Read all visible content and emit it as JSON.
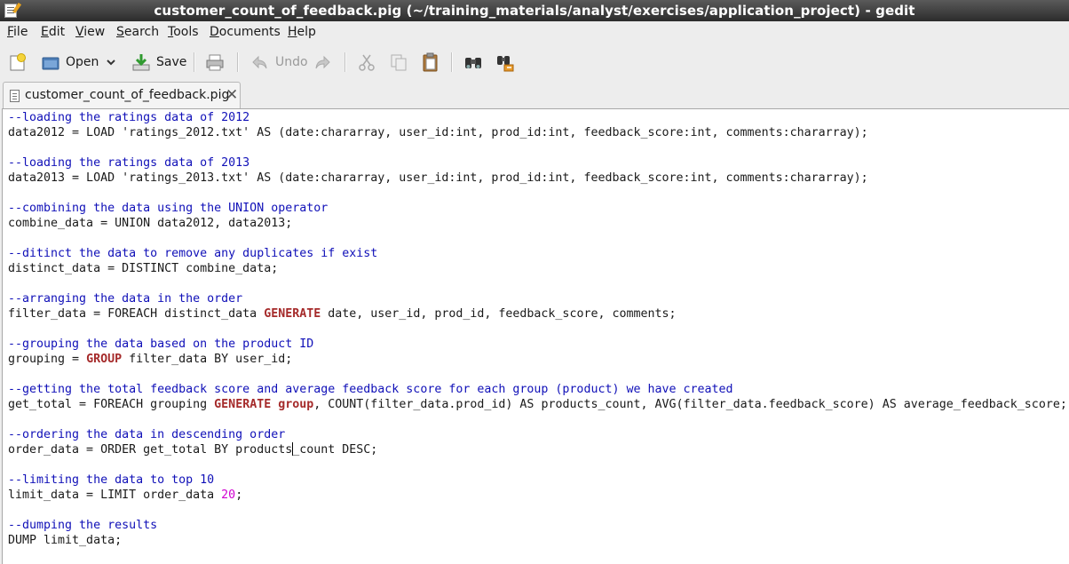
{
  "window": {
    "title": "customer_count_of_feedback.pig (~/training_materials/analyst/exercises/application_project) - gedit"
  },
  "menu": [
    "File",
    "Edit",
    "View",
    "Search",
    "Tools",
    "Documents",
    "Help"
  ],
  "toolbar": {
    "open_label": "Open",
    "save_label": "Save",
    "undo_label": "Undo"
  },
  "tab": {
    "label": "customer_count_of_feedback.pig"
  },
  "code": {
    "l1": "--loading the ratings data of 2012",
    "l2": "data2012 = LOAD 'ratings_2012.txt' AS (date:chararray, user_id:int, prod_id:int, feedback_score:int, comments:chararray);",
    "l3": "--loading the ratings data of 2013",
    "l4": "data2013 = LOAD 'ratings_2013.txt' AS (date:chararray, user_id:int, prod_id:int, feedback_score:int, comments:chararray);",
    "l5": "--combining the data using the UNION operator",
    "l6": "combine_data = UNION data2012, data2013;",
    "l7": "--ditinct the data to remove any duplicates if exist",
    "l8": "distinct_data = DISTINCT combine_data;",
    "l9": "--arranging the data in the order",
    "l10a": "filter_data = FOREACH distinct_data ",
    "l10b": "GENERATE",
    "l10c": " date, user_id, prod_id, feedback_score, comments;",
    "l11": "--grouping the data based on the product ID",
    "l12a": "grouping = ",
    "l12b": "GROUP",
    "l12c": " filter_data BY user_id;",
    "l13": "--getting the total feedback score and average feedback score for each group (product) we have created",
    "l14a": "get_total = FOREACH grouping ",
    "l14b": "GENERATE",
    "l14c": " ",
    "l14d": "group",
    "l14e": ", COUNT(filter_data.prod_id) AS products_count, AVG(filter_data.feedback_score) AS average_feedback_score;",
    "l15": "--ordering the data in descending order",
    "l16a": "order_data = ORDER get_total BY products",
    "l16b": "_count DESC;",
    "l17": "--limiting the data to top 10",
    "l18a": "limit_data = LIMIT order_data ",
    "l18b": "20",
    "l18c": ";",
    "l19": "--dumping the results",
    "l20": "DUMP limit_data;"
  }
}
